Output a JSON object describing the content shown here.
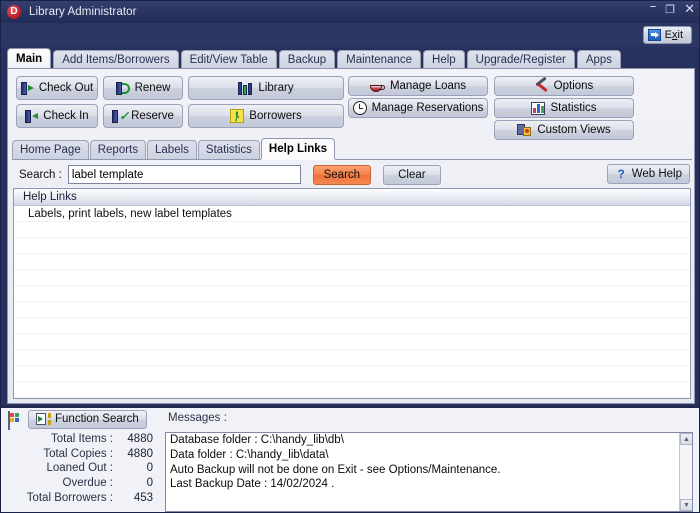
{
  "window": {
    "title": "Library Administrator",
    "app_icon_letter": "D",
    "controls": {
      "minimize": "–",
      "maximize": "❐",
      "close": "✕"
    },
    "exit_label": "Exit"
  },
  "main_tabs": [
    {
      "label": "Main",
      "active": true
    },
    {
      "label": "Add Items/Borrowers",
      "active": false
    },
    {
      "label": "Edit/View Table",
      "active": false
    },
    {
      "label": "Backup",
      "active": false
    },
    {
      "label": "Maintenance",
      "active": false
    },
    {
      "label": "Help",
      "active": false
    },
    {
      "label": "Upgrade/Register",
      "active": false
    },
    {
      "label": "Apps",
      "active": false
    }
  ],
  "actions": {
    "check_out": "Check Out",
    "renew": "Renew",
    "library": "Library",
    "check_in": "Check In",
    "reserve": "Reserve",
    "borrowers": "Borrowers",
    "manage_loans": "Manage Loans",
    "manage_reservations": "Manage Reservations",
    "options": "Options",
    "statistics": "Statistics",
    "custom_views": "Custom Views"
  },
  "sub_tabs": [
    {
      "label": "Home Page",
      "active": false
    },
    {
      "label": "Reports",
      "active": false
    },
    {
      "label": "Labels",
      "active": false
    },
    {
      "label": "Statistics",
      "active": false
    },
    {
      "label": "Help Links",
      "active": true
    }
  ],
  "search": {
    "label": "Search :",
    "value": "label template",
    "placeholder": "",
    "search_button": "Search",
    "clear_button": "Clear",
    "web_help_button": "Web Help",
    "search_button_color": "#f5814a"
  },
  "results": {
    "column_header": "Help Links",
    "rows": [
      "Labels, print labels, new label templates"
    ]
  },
  "bottom": {
    "function_search_button": "Function Search",
    "messages_label": "Messages :",
    "stats": [
      {
        "label": "Total Items :",
        "value": "4880"
      },
      {
        "label": "Total Copies :",
        "value": "4880"
      },
      {
        "label": "Loaned Out :",
        "value": "0"
      },
      {
        "label": "Overdue :",
        "value": "0"
      },
      {
        "label": "Total Borrowers :",
        "value": "453"
      }
    ],
    "messages": [
      "Database folder : C:\\handy_lib\\db\\",
      "Data folder : C:\\handy_lib\\data\\",
      "Auto Backup will not be done on Exit - see Options/Maintenance.",
      "Last Backup Date : 14/02/2024 ."
    ]
  }
}
